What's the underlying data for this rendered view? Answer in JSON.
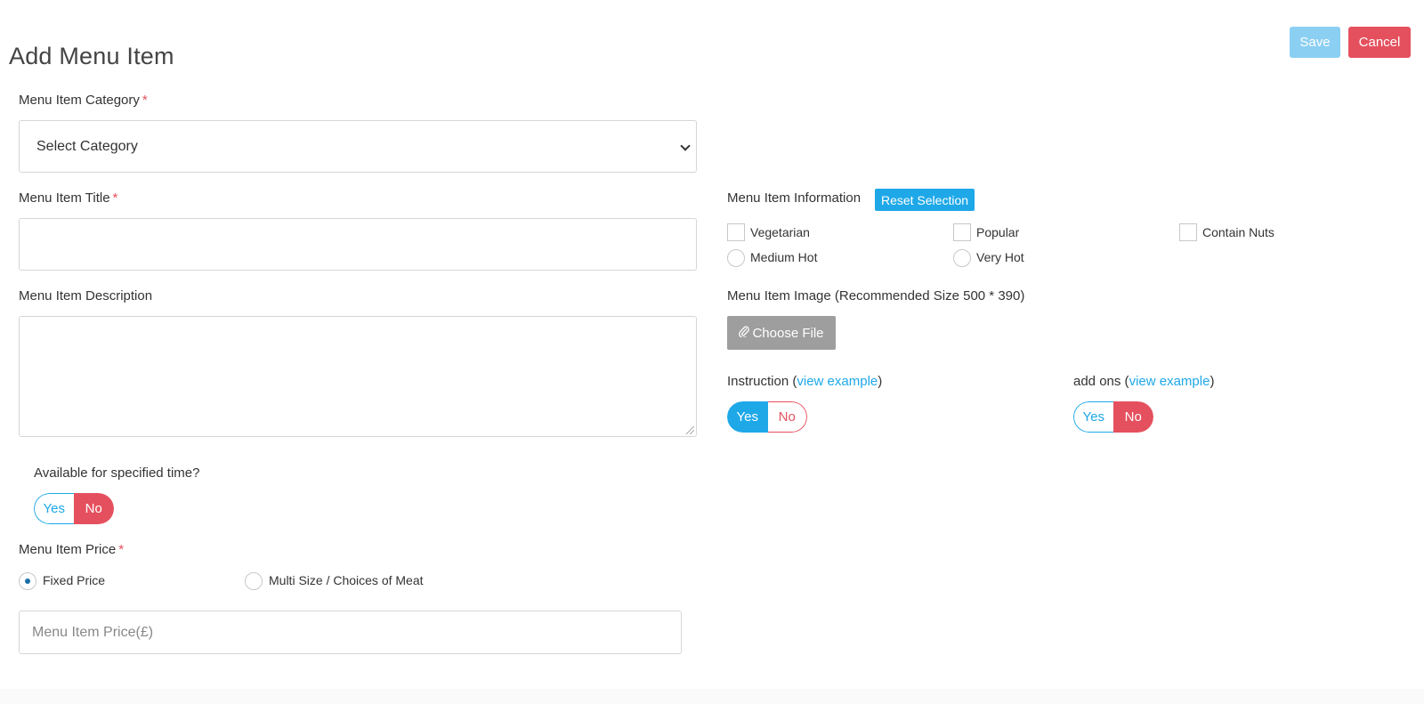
{
  "header": {
    "title": "Add Menu Item",
    "save_label": "Save",
    "cancel_label": "Cancel"
  },
  "category": {
    "label": "Menu Item Category",
    "required_mark": "*",
    "selected": "Select Category"
  },
  "title_field": {
    "label": "Menu Item Title",
    "required_mark": "*",
    "value": ""
  },
  "description": {
    "label": "Menu Item Description",
    "value": ""
  },
  "availability": {
    "label": "Available for specified time?",
    "yes": "Yes",
    "no": "No",
    "selected": "No"
  },
  "price": {
    "label": "Menu Item Price",
    "required_mark": "*",
    "options": [
      "Fixed Price",
      "Multi Size / Choices of Meat"
    ],
    "selected": "Fixed Price",
    "placeholder": "Menu Item Price(£)"
  },
  "info": {
    "label": "Menu Item Information",
    "reset_label": "Reset Selection",
    "checkboxes": [
      "Vegetarian",
      "Popular",
      "Contain Nuts"
    ],
    "radios": [
      "Medium Hot",
      "Very Hot"
    ]
  },
  "image": {
    "label": "Menu Item Image (Recommended Size 500 * 390)",
    "button_label": "Choose File",
    "button_icon": "paperclip-icon"
  },
  "instruction": {
    "label": "Instruction",
    "link": "view example",
    "yes": "Yes",
    "no": "No",
    "selected": "Yes"
  },
  "addons": {
    "label": "add ons",
    "link": "view example",
    "yes": "Yes",
    "no": "No",
    "selected": "No"
  },
  "colors": {
    "primary": "#1ea8e8",
    "danger": "#e5505e",
    "save_disabled": "#8bcff3",
    "file_button": "#9e9e9e"
  }
}
